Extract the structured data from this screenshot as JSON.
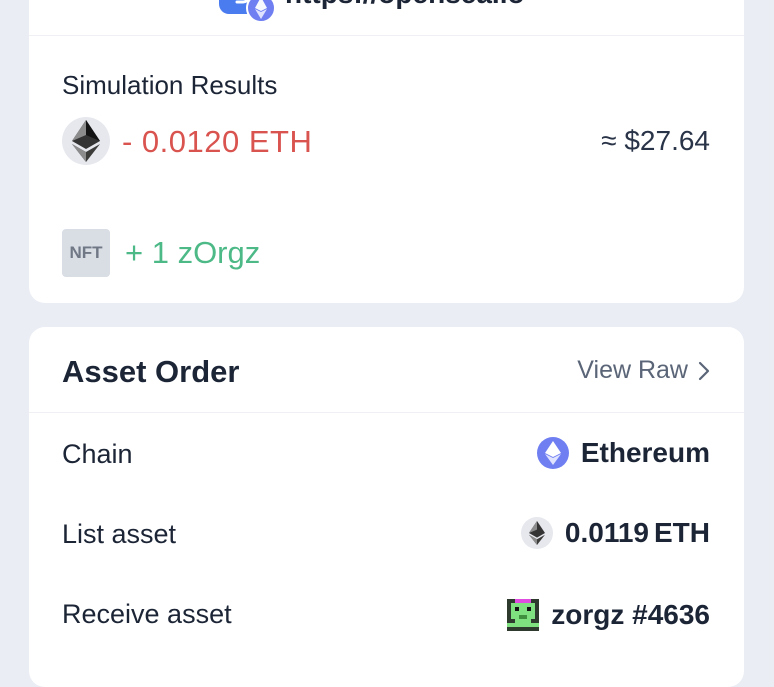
{
  "site": {
    "url": "https://opensea.io",
    "icon": "opensea-link-icon"
  },
  "simulation": {
    "title": "Simulation Results",
    "eth_change": "- 0.0120 ETH",
    "usd_value": "≈ $27.64",
    "nft_badge": "NFT",
    "nft_change": "+ 1 zOrgz",
    "colors": {
      "negative": "#d9534f",
      "positive": "#4cb987"
    }
  },
  "asset_order": {
    "title": "Asset Order",
    "view_raw": "View Raw",
    "rows": [
      {
        "label": "Chain",
        "value": "Ethereum",
        "icon": "ethereum-chain-icon"
      },
      {
        "label": "List asset",
        "value": "0.0119",
        "unit": "ETH",
        "icon": "eth-token-icon"
      },
      {
        "label": "Receive asset",
        "value": "zorgz #4636",
        "icon": "zorgz-nft-avatar"
      }
    ]
  }
}
